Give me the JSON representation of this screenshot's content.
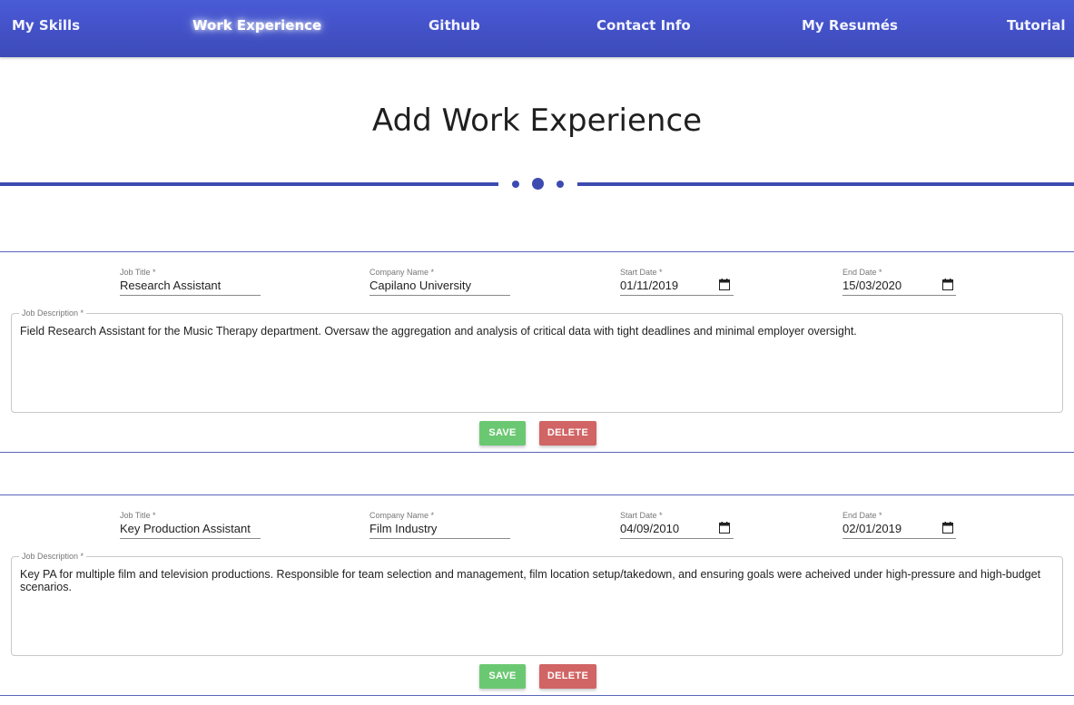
{
  "nav": {
    "items": [
      {
        "label": "My Skills"
      },
      {
        "label": "Work Experience"
      },
      {
        "label": "Github"
      },
      {
        "label": "Contact Info"
      },
      {
        "label": "My Resumés"
      },
      {
        "label": "Tutorial"
      }
    ],
    "active_index": 1
  },
  "page": {
    "title": "Add Work Experience"
  },
  "form_labels": {
    "job_title": "Job Title *",
    "company_name": "Company Name *",
    "start_date": "Start Date *",
    "end_date": "End Date *",
    "job_description": "Job Description *",
    "save": "SAVE",
    "delete": "DELETE"
  },
  "experiences": [
    {
      "job_title": "Research Assistant",
      "company_name": "Capilano University",
      "start_date": "01/11/2019",
      "end_date": "15/03/2020",
      "job_description": "Field Research Assistant for the Music Therapy department. Oversaw the aggregation and analysis of critical data with tight deadlines and minimal employer oversight."
    },
    {
      "job_title": "Key Production Assistant",
      "company_name": "Film Industry",
      "start_date": "04/09/2010",
      "end_date": "02/01/2019",
      "job_description": "Key PA for multiple film and television productions. Responsible for team selection and management, film location setup/takedown, and ensuring goals were acheived under high-pressure and high-budget scenarios."
    }
  ],
  "colors": {
    "nav_gradient_top": "#4a5bd8",
    "accent": "#3c4bb0",
    "save_button": "#6bc872",
    "delete_button": "#d16464"
  },
  "icons": {
    "date_picker": "calendar-icon"
  }
}
